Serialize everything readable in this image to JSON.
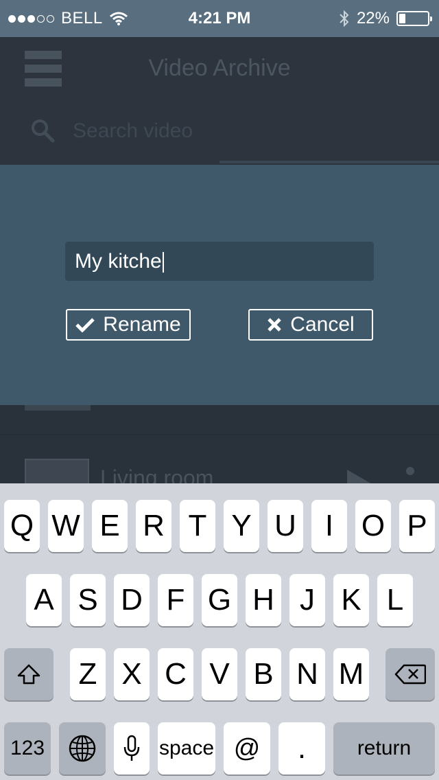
{
  "status_bar": {
    "carrier": "BELL",
    "time": "4:21 PM",
    "battery_percent": "22%",
    "battery_level": 0.22,
    "signal_bars_filled": 3,
    "signal_bars_total": 5
  },
  "header": {
    "title": "Video Archive",
    "search_placeholder": "Search video"
  },
  "list": {
    "items": [
      {
        "title": "Living room"
      }
    ]
  },
  "dialog": {
    "input_value": "My kitche",
    "rename_label": "Rename",
    "cancel_label": "Cancel"
  },
  "keyboard": {
    "row1": [
      "Q",
      "W",
      "E",
      "R",
      "T",
      "Y",
      "U",
      "I",
      "O",
      "P"
    ],
    "row2": [
      "A",
      "S",
      "D",
      "F",
      "G",
      "H",
      "J",
      "K",
      "L"
    ],
    "row3": [
      "Z",
      "X",
      "C",
      "V",
      "B",
      "N",
      "M"
    ],
    "numbers_label": "123",
    "space_label": "space",
    "at_label": "@",
    "period_label": ".",
    "return_label": "return"
  },
  "colors": {
    "status_bar": "#596f7f",
    "dialog": "#40596a",
    "input": "#334856",
    "keyboard": "#d1d5db"
  }
}
